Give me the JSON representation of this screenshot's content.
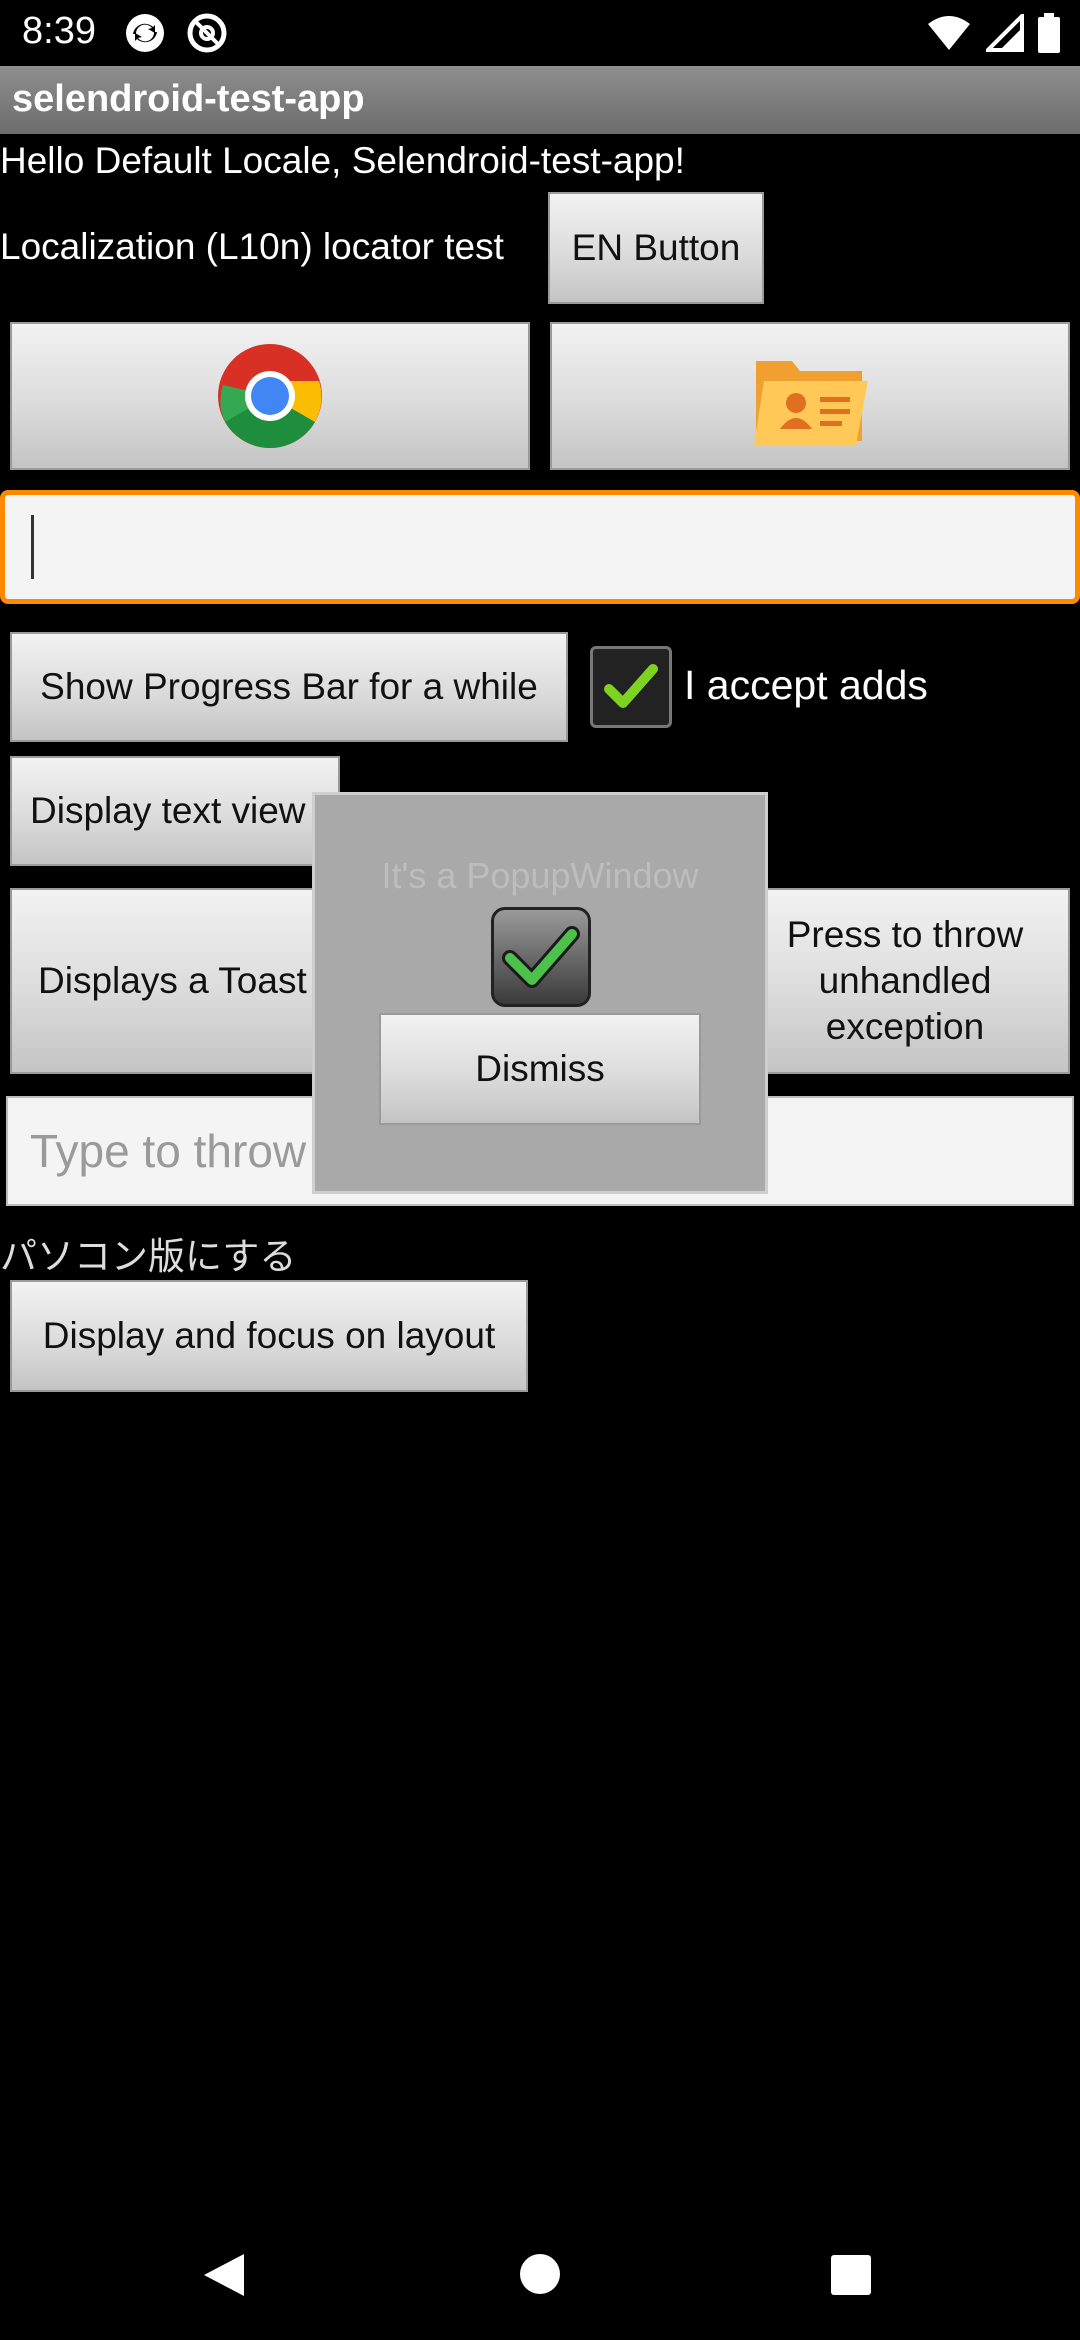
{
  "status_bar": {
    "time": "8:39",
    "icons": [
      "sync-icon",
      "at-icon",
      "wifi-icon",
      "signal-icon",
      "battery-icon"
    ]
  },
  "app": {
    "title": "selendroid-test-app"
  },
  "main": {
    "hello_text": "Hello Default Locale, Selendroid-test-app!",
    "l10n_label": "Localization (L10n) locator test",
    "en_button": "EN Button",
    "chrome_button_icon": "chrome-icon",
    "contacts_button_icon": "contacts-folder-icon",
    "text_input_value": "",
    "progress_button": "Show Progress Bar for a while",
    "checkbox_label": "I accept adds",
    "checkbox_checked": true,
    "display_text_view_button": "Display text view",
    "displays_toast_button": "Displays a Toast",
    "throw_exception_button": "Press to throw unhandled exception",
    "throw_input_placeholder": "Type to throw unhandled exception",
    "japanese_text": "パソコン版にする",
    "focus_layout_button": "Display and focus on layout"
  },
  "popup": {
    "title": "It's a PopupWindow",
    "dismiss_button": "Dismiss"
  },
  "nav": {
    "icons": [
      "back-icon",
      "home-icon",
      "recents-icon"
    ]
  },
  "colors": {
    "focus_border": "#ff8a00",
    "title_bar": "#7d7d7d",
    "check_green": "#7ed321"
  }
}
